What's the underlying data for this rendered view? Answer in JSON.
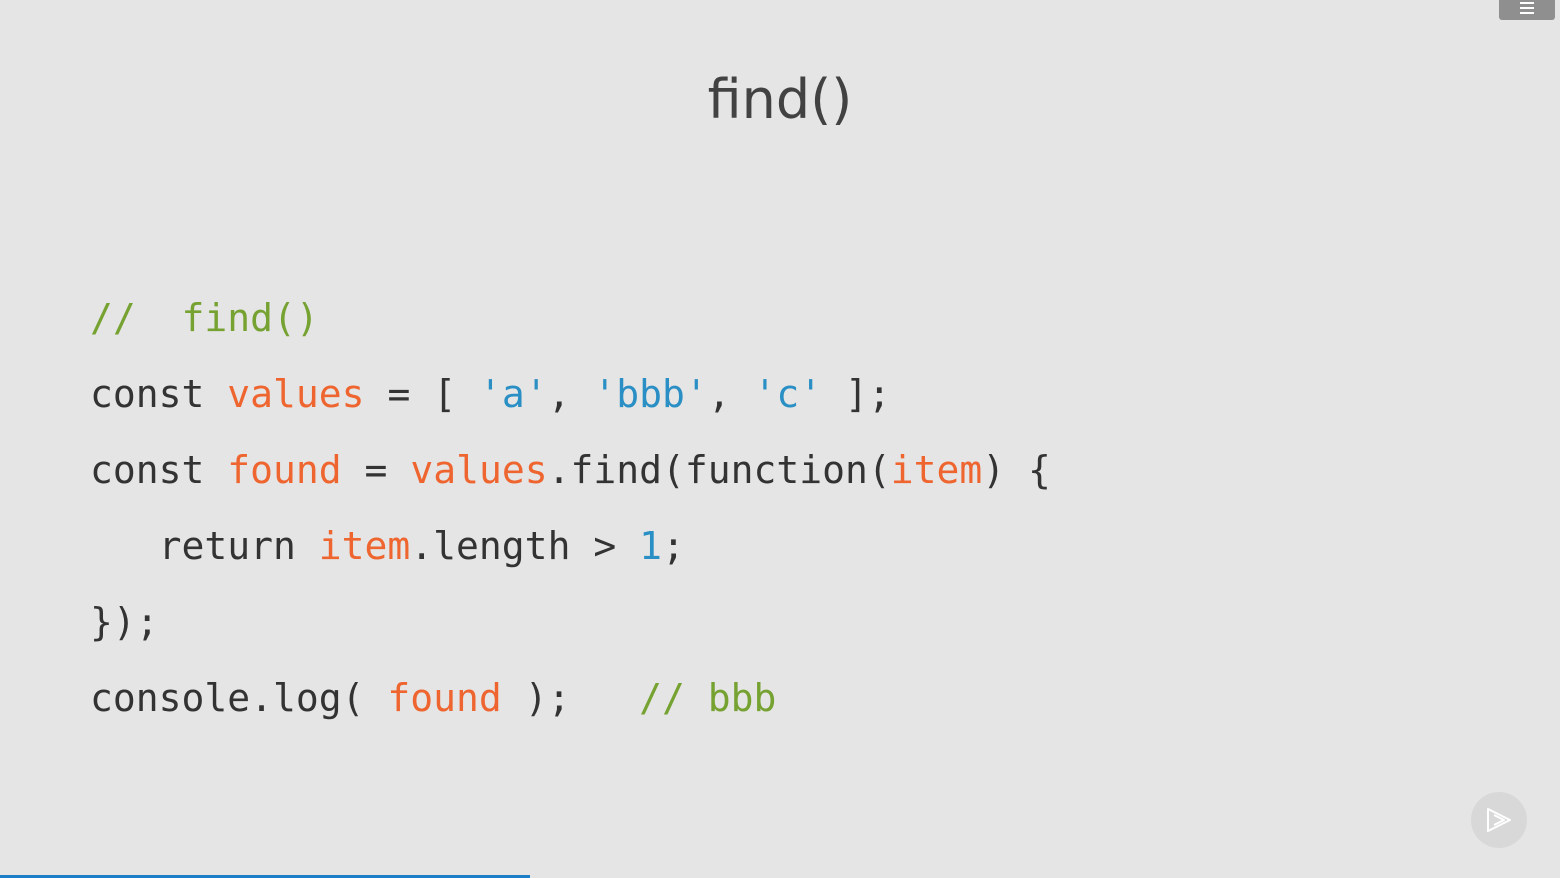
{
  "slide": {
    "title": "find()"
  },
  "code": {
    "lines": [
      [
        {
          "t": "comment",
          "v": "//  find()"
        }
      ],
      [
        {
          "t": "plain",
          "v": "const "
        },
        {
          "t": "var",
          "v": "values"
        },
        {
          "t": "plain",
          "v": " = [ "
        },
        {
          "t": "str",
          "v": "'a'"
        },
        {
          "t": "plain",
          "v": ", "
        },
        {
          "t": "str",
          "v": "'bbb'"
        },
        {
          "t": "plain",
          "v": ", "
        },
        {
          "t": "str",
          "v": "'c'"
        },
        {
          "t": "plain",
          "v": " ];"
        }
      ],
      [
        {
          "t": "plain",
          "v": "const "
        },
        {
          "t": "var",
          "v": "found"
        },
        {
          "t": "plain",
          "v": " = "
        },
        {
          "t": "var",
          "v": "values"
        },
        {
          "t": "plain",
          "v": ".find(function("
        },
        {
          "t": "var",
          "v": "item"
        },
        {
          "t": "plain",
          "v": ") {"
        }
      ],
      [
        {
          "t": "plain",
          "v": "   return "
        },
        {
          "t": "var",
          "v": "item"
        },
        {
          "t": "plain",
          "v": ".length > "
        },
        {
          "t": "num",
          "v": "1"
        },
        {
          "t": "plain",
          "v": ";"
        }
      ],
      [
        {
          "t": "plain",
          "v": "});"
        }
      ],
      [
        {
          "t": "plain",
          "v": "console.log( "
        },
        {
          "t": "var",
          "v": "found"
        },
        {
          "t": "plain",
          "v": " );   "
        },
        {
          "t": "comment",
          "v": "// bbb"
        }
      ]
    ]
  },
  "player": {
    "progress": 0.34,
    "menu_icon": "hamburger-icon",
    "play_icon": "play-icon"
  },
  "colors": {
    "background": "#e5e5e5",
    "comment": "#76a232",
    "variable": "#ee6530",
    "string": "#2a8fc4",
    "text": "#333333",
    "progress": "#1c7ec6"
  }
}
